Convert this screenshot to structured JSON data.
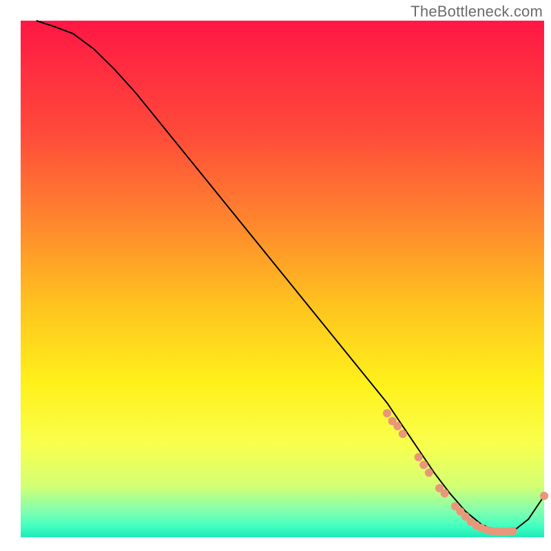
{
  "watermark": "TheBottleneck.com",
  "chart_data": {
    "type": "line",
    "title": "",
    "xlabel": "",
    "ylabel": "",
    "xlim": [
      0,
      100
    ],
    "ylim": [
      0,
      100
    ],
    "background_gradient": {
      "stops": [
        {
          "offset": 0.0,
          "color": "#ff1744"
        },
        {
          "offset": 0.22,
          "color": "#ff4b3a"
        },
        {
          "offset": 0.4,
          "color": "#ff8a2d"
        },
        {
          "offset": 0.55,
          "color": "#ffc31f"
        },
        {
          "offset": 0.7,
          "color": "#fff01a"
        },
        {
          "offset": 0.82,
          "color": "#f9ff4d"
        },
        {
          "offset": 0.9,
          "color": "#d4ff73"
        },
        {
          "offset": 0.95,
          "color": "#80ffb0"
        },
        {
          "offset": 0.98,
          "color": "#3fffc1"
        },
        {
          "offset": 1.0,
          "color": "#1de9b6"
        }
      ]
    },
    "series": [
      {
        "name": "bottleneck-curve",
        "color": "#000000",
        "x": [
          3,
          6,
          10,
          14,
          18,
          22,
          26,
          30,
          34,
          38,
          42,
          46,
          50,
          54,
          58,
          62,
          66,
          70,
          73,
          76,
          79,
          82,
          85,
          88,
          91,
          94,
          97,
          100
        ],
        "y": [
          100,
          99,
          97.5,
          94.5,
          90.5,
          86,
          81,
          76,
          71,
          66,
          61,
          56,
          51,
          46,
          41,
          36,
          31,
          26,
          21.5,
          17,
          12.5,
          8.5,
          5,
          2.5,
          1.2,
          1.1,
          3.5,
          8
        ]
      }
    ],
    "markers": {
      "name": "highlighted-points",
      "color": "#e9967a",
      "radius": 6,
      "points": [
        {
          "x": 70,
          "y": 24
        },
        {
          "x": 71,
          "y": 22.5
        },
        {
          "x": 72,
          "y": 21.5
        },
        {
          "x": 73,
          "y": 20
        },
        {
          "x": 76,
          "y": 15.5
        },
        {
          "x": 77,
          "y": 14
        },
        {
          "x": 78,
          "y": 12.5
        },
        {
          "x": 80,
          "y": 9.5
        },
        {
          "x": 81,
          "y": 8.5
        },
        {
          "x": 83,
          "y": 6
        },
        {
          "x": 84,
          "y": 5
        },
        {
          "x": 85,
          "y": 4
        },
        {
          "x": 86,
          "y": 3
        },
        {
          "x": 87,
          "y": 2.3
        },
        {
          "x": 88,
          "y": 1.8
        },
        {
          "x": 89,
          "y": 1.4
        },
        {
          "x": 90,
          "y": 1.2
        },
        {
          "x": 91,
          "y": 1.1
        },
        {
          "x": 92,
          "y": 1.1
        },
        {
          "x": 93,
          "y": 1.1
        },
        {
          "x": 94,
          "y": 1.2
        },
        {
          "x": 100,
          "y": 8
        }
      ]
    }
  }
}
